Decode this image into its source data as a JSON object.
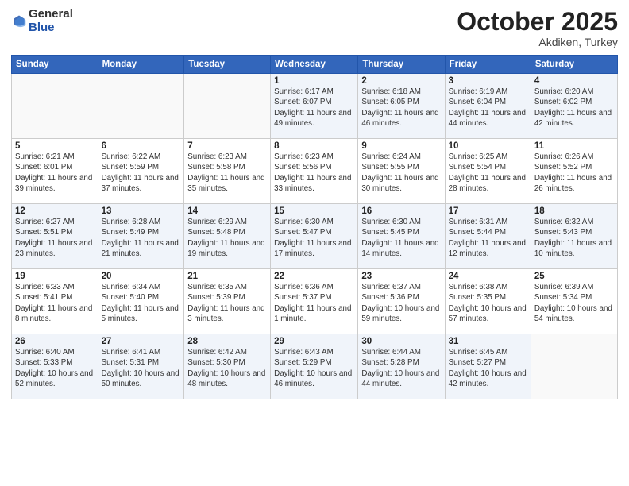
{
  "header": {
    "logo_general": "General",
    "logo_blue": "Blue",
    "month_title": "October 2025",
    "location": "Akdiken, Turkey"
  },
  "days_of_week": [
    "Sunday",
    "Monday",
    "Tuesday",
    "Wednesday",
    "Thursday",
    "Friday",
    "Saturday"
  ],
  "weeks": [
    [
      {
        "day": "",
        "info": ""
      },
      {
        "day": "",
        "info": ""
      },
      {
        "day": "",
        "info": ""
      },
      {
        "day": "1",
        "info": "Sunrise: 6:17 AM\nSunset: 6:07 PM\nDaylight: 11 hours and 49 minutes."
      },
      {
        "day": "2",
        "info": "Sunrise: 6:18 AM\nSunset: 6:05 PM\nDaylight: 11 hours and 46 minutes."
      },
      {
        "day": "3",
        "info": "Sunrise: 6:19 AM\nSunset: 6:04 PM\nDaylight: 11 hours and 44 minutes."
      },
      {
        "day": "4",
        "info": "Sunrise: 6:20 AM\nSunset: 6:02 PM\nDaylight: 11 hours and 42 minutes."
      }
    ],
    [
      {
        "day": "5",
        "info": "Sunrise: 6:21 AM\nSunset: 6:01 PM\nDaylight: 11 hours and 39 minutes."
      },
      {
        "day": "6",
        "info": "Sunrise: 6:22 AM\nSunset: 5:59 PM\nDaylight: 11 hours and 37 minutes."
      },
      {
        "day": "7",
        "info": "Sunrise: 6:23 AM\nSunset: 5:58 PM\nDaylight: 11 hours and 35 minutes."
      },
      {
        "day": "8",
        "info": "Sunrise: 6:23 AM\nSunset: 5:56 PM\nDaylight: 11 hours and 33 minutes."
      },
      {
        "day": "9",
        "info": "Sunrise: 6:24 AM\nSunset: 5:55 PM\nDaylight: 11 hours and 30 minutes."
      },
      {
        "day": "10",
        "info": "Sunrise: 6:25 AM\nSunset: 5:54 PM\nDaylight: 11 hours and 28 minutes."
      },
      {
        "day": "11",
        "info": "Sunrise: 6:26 AM\nSunset: 5:52 PM\nDaylight: 11 hours and 26 minutes."
      }
    ],
    [
      {
        "day": "12",
        "info": "Sunrise: 6:27 AM\nSunset: 5:51 PM\nDaylight: 11 hours and 23 minutes."
      },
      {
        "day": "13",
        "info": "Sunrise: 6:28 AM\nSunset: 5:49 PM\nDaylight: 11 hours and 21 minutes."
      },
      {
        "day": "14",
        "info": "Sunrise: 6:29 AM\nSunset: 5:48 PM\nDaylight: 11 hours and 19 minutes."
      },
      {
        "day": "15",
        "info": "Sunrise: 6:30 AM\nSunset: 5:47 PM\nDaylight: 11 hours and 17 minutes."
      },
      {
        "day": "16",
        "info": "Sunrise: 6:30 AM\nSunset: 5:45 PM\nDaylight: 11 hours and 14 minutes."
      },
      {
        "day": "17",
        "info": "Sunrise: 6:31 AM\nSunset: 5:44 PM\nDaylight: 11 hours and 12 minutes."
      },
      {
        "day": "18",
        "info": "Sunrise: 6:32 AM\nSunset: 5:43 PM\nDaylight: 11 hours and 10 minutes."
      }
    ],
    [
      {
        "day": "19",
        "info": "Sunrise: 6:33 AM\nSunset: 5:41 PM\nDaylight: 11 hours and 8 minutes."
      },
      {
        "day": "20",
        "info": "Sunrise: 6:34 AM\nSunset: 5:40 PM\nDaylight: 11 hours and 5 minutes."
      },
      {
        "day": "21",
        "info": "Sunrise: 6:35 AM\nSunset: 5:39 PM\nDaylight: 11 hours and 3 minutes."
      },
      {
        "day": "22",
        "info": "Sunrise: 6:36 AM\nSunset: 5:37 PM\nDaylight: 11 hours and 1 minute."
      },
      {
        "day": "23",
        "info": "Sunrise: 6:37 AM\nSunset: 5:36 PM\nDaylight: 10 hours and 59 minutes."
      },
      {
        "day": "24",
        "info": "Sunrise: 6:38 AM\nSunset: 5:35 PM\nDaylight: 10 hours and 57 minutes."
      },
      {
        "day": "25",
        "info": "Sunrise: 6:39 AM\nSunset: 5:34 PM\nDaylight: 10 hours and 54 minutes."
      }
    ],
    [
      {
        "day": "26",
        "info": "Sunrise: 6:40 AM\nSunset: 5:33 PM\nDaylight: 10 hours and 52 minutes."
      },
      {
        "day": "27",
        "info": "Sunrise: 6:41 AM\nSunset: 5:31 PM\nDaylight: 10 hours and 50 minutes."
      },
      {
        "day": "28",
        "info": "Sunrise: 6:42 AM\nSunset: 5:30 PM\nDaylight: 10 hours and 48 minutes."
      },
      {
        "day": "29",
        "info": "Sunrise: 6:43 AM\nSunset: 5:29 PM\nDaylight: 10 hours and 46 minutes."
      },
      {
        "day": "30",
        "info": "Sunrise: 6:44 AM\nSunset: 5:28 PM\nDaylight: 10 hours and 44 minutes."
      },
      {
        "day": "31",
        "info": "Sunrise: 6:45 AM\nSunset: 5:27 PM\nDaylight: 10 hours and 42 minutes."
      },
      {
        "day": "",
        "info": ""
      }
    ]
  ]
}
